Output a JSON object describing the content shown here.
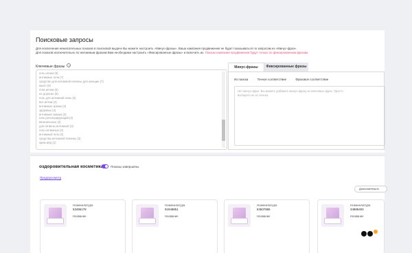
{
  "page": {
    "title": "Поисковые запросы",
    "description_line1": "Для исключения нежелательных показов в поисковой выдаче Вы можете настроить «Минус-фразы». Ваша кампания продвижения не будет показываться по запросам из «Минус-фраз».",
    "description_line2_start": "Для показов исключительно по желаемым фразам Вам необходимо настроить «Фиксированные фразы» и включить их.",
    "description_line2_highlight": "Показы кампании продвижения будут только по фиксированным фразам."
  },
  "keywords": {
    "label": "Ключевые фразы",
    "items": [
      "гель интим (8)",
      "интимные гели (7)",
      "средство для интимной гигиены для женщин (7)",
      "мыло (6)",
      "гели интим (6)",
      "не дорогие (5)",
      "гель для интимной зоны (5)",
      "все интим (4)",
      "интимные кремы (4)",
      "здоровье (4)",
      "интимная смазка (4)",
      "гель регенерирующий (3)",
      "вагинальные (3)",
      "для гигиены интимной (3)",
      "гель интимные (3)",
      "интимный гель (3)",
      "средства интимной гигиены (3)",
      "крем мёд (2)"
    ]
  },
  "tabs": {
    "minus": "Минус-фразы",
    "fixed": "Фиксированные фразы"
  },
  "subtabs": [
    "Из поиска",
    "Точное соответствие",
    "Фразовое соответствие"
  ],
  "phrase_area": {
    "placeholder": "Нет минус-фраз. Вы можете добавить минус-фразу из ключевых фраз. Просто выберите их из списка."
  },
  "campaign": {
    "title": "оздоровительная косметика",
    "toggle_label": "Показы завершены",
    "toggle_on": true,
    "preview_link": "Предпросмотр",
    "more_button": "Дополнительно"
  },
  "cards": [
    {
      "nomenclature_label": "Номенклатура",
      "nomenclature": "53496178",
      "name_label": "Название"
    },
    {
      "nomenclature_label": "Номенклатура",
      "nomenclature": "91948851",
      "name_label": "Название"
    },
    {
      "nomenclature_label": "Номенклатура",
      "nomenclature": "84507886",
      "name_label": "Название"
    },
    {
      "nomenclature_label": "Номенклатура",
      "nomenclature": "34885493",
      "name_label": "Название"
    }
  ],
  "colors": {
    "accent": "#7b45e8",
    "highlight": "#e9517e",
    "logo_dot": "#f5a623"
  }
}
